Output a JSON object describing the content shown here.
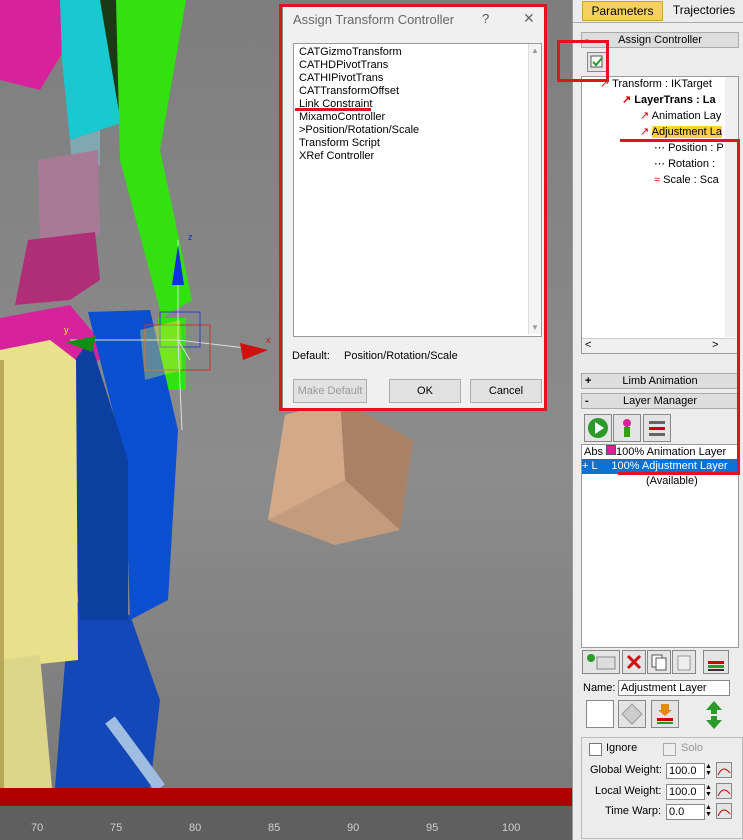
{
  "dialog": {
    "title": "Assign Transform Controller",
    "help": "?",
    "close": "✕",
    "items": [
      "CATGizmoTransform",
      "CATHDPivotTrans",
      "CATHIPivotTrans",
      "CATTransformOffset",
      "Link Constraint",
      "MixamoController",
      ">Position/Rotation/Scale",
      "Transform Script",
      "XRef Controller"
    ],
    "default_label": "Default:",
    "default_value": "Position/Rotation/Scale",
    "make_default": "Make Default",
    "ok": "OK",
    "cancel": "Cancel"
  },
  "panel": {
    "tabs": [
      "Parameters",
      "Trajectories"
    ],
    "assign_controller": "Assign Controller",
    "tree": [
      "Transform : IKTarget",
      "LayerTrans : La",
      "Animation Lay",
      "Adjustment La",
      "Position : P",
      "Rotation :",
      "Scale : Sca"
    ],
    "limb_animation": "Limb Animation",
    "layer_manager": "Layer Manager",
    "layers": [
      {
        "prefix": "Abs",
        "label": "100% Animation Layer"
      },
      {
        "prefix": "+ L",
        "label": "100% Adjustment Layer"
      }
    ],
    "available": "(Available)",
    "name_label": "Name:",
    "name_value": "Adjustment Layer",
    "ignore": "Ignore",
    "solo": "Solo",
    "global_weight_label": "Global Weight:",
    "global_weight": "100.0",
    "local_weight_label": "Local Weight:",
    "local_weight": "100.0",
    "time_warp_label": "Time Warp:",
    "time_warp": "0.0"
  },
  "viewport": {
    "axis_x": "x",
    "axis_y": "y",
    "axis_z": "z",
    "ruler": [
      "70",
      "75",
      "80",
      "85",
      "90",
      "95",
      "100"
    ]
  },
  "colors": {
    "highlight_red": "#e0141f",
    "selection_blue": "#0a72d6",
    "adjustment_yellow": "#ffcf40"
  }
}
